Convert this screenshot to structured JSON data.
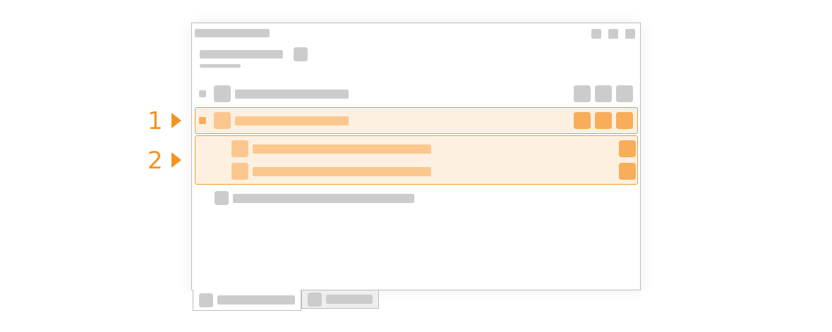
{
  "window": {
    "controls": [
      {
        "kind": "button"
      },
      {
        "kind": "button"
      },
      {
        "kind": "button"
      }
    ]
  },
  "groups": [
    {
      "rows": [
        {
          "kind": "parent",
          "selected": false,
          "actions": [
            {
              "kind": "button"
            },
            {
              "kind": "button"
            },
            {
              "kind": "button"
            }
          ]
        }
      ]
    },
    {
      "highlighted": true,
      "callout": "1",
      "rows": [
        {
          "kind": "parent",
          "selected": true,
          "actions": [
            {
              "kind": "button"
            },
            {
              "kind": "button"
            },
            {
              "kind": "button"
            }
          ]
        }
      ]
    },
    {
      "highlighted": true,
      "callout": "2",
      "rows": [
        {
          "kind": "child",
          "actions": [
            {
              "kind": "button"
            }
          ]
        },
        {
          "kind": "child",
          "actions": [
            {
              "kind": "button"
            }
          ]
        }
      ]
    },
    {
      "rows": [
        {
          "kind": "entry",
          "actions": []
        }
      ]
    }
  ],
  "tabs": [
    {
      "selected": true
    },
    {
      "selected": false
    }
  ]
}
